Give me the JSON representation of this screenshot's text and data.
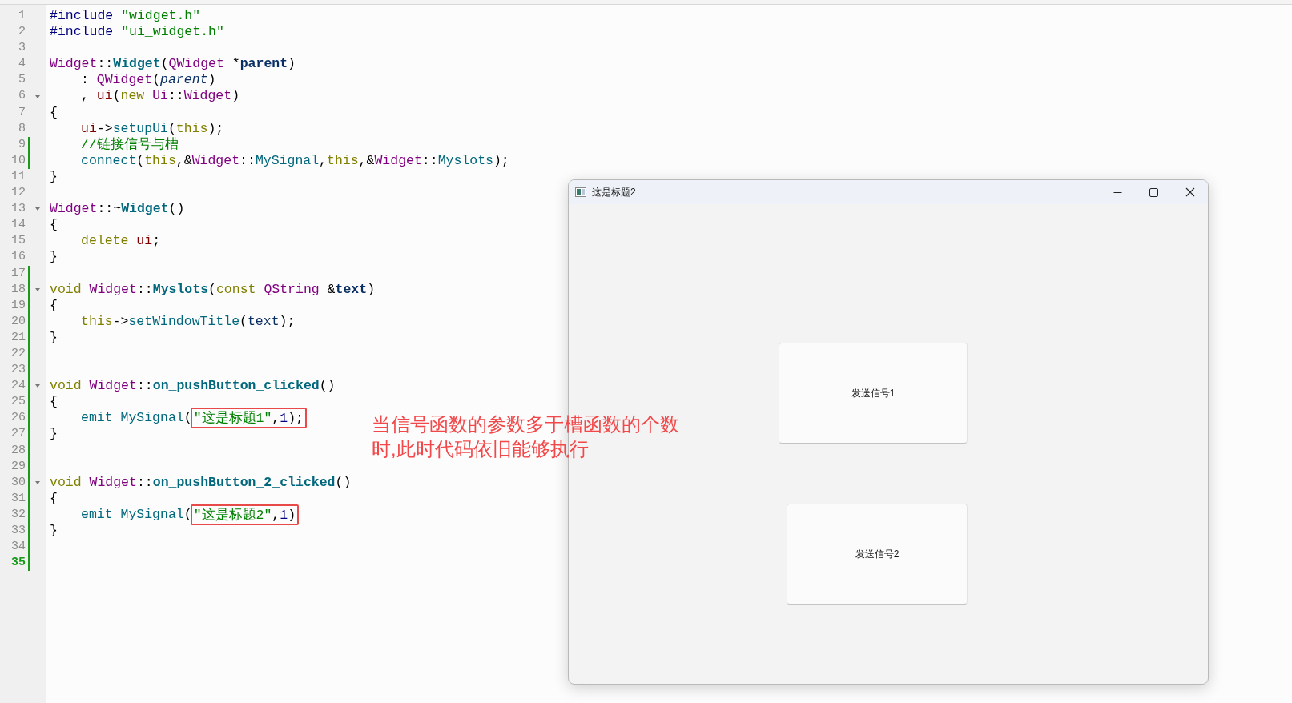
{
  "editor": {
    "lines": [
      {
        "number": "1",
        "foldable": false,
        "modified": false,
        "current": false,
        "indent": false,
        "tokens": [
          {
            "text": "#include ",
            "kind": "preproc"
          },
          {
            "text": "\"widget.h\"",
            "kind": "string"
          }
        ]
      },
      {
        "number": "2",
        "foldable": false,
        "modified": false,
        "current": false,
        "indent": false,
        "tokens": [
          {
            "text": "#include ",
            "kind": "preproc"
          },
          {
            "text": "\"ui_widget.h\"",
            "kind": "string"
          }
        ]
      },
      {
        "number": "3",
        "foldable": false,
        "modified": false,
        "current": false,
        "indent": false
      },
      {
        "number": "4",
        "foldable": false,
        "modified": false,
        "current": false,
        "indent": false,
        "tokens": [
          {
            "text": "Widget",
            "kind": "type"
          },
          {
            "text": "::",
            "kind": "plain"
          },
          {
            "text": "Widget",
            "kind": "decl"
          },
          {
            "text": "(",
            "kind": "plain"
          },
          {
            "text": "QWidget",
            "kind": "type"
          },
          {
            "text": " *",
            "kind": "plain"
          },
          {
            "text": "parent",
            "kind": "param"
          },
          {
            "text": ")",
            "kind": "plain"
          }
        ]
      },
      {
        "number": "5",
        "foldable": false,
        "modified": false,
        "current": false,
        "indent": true,
        "tokens": [
          {
            "text": ": ",
            "kind": "plain"
          },
          {
            "text": "QWidget",
            "kind": "type"
          },
          {
            "text": "(",
            "kind": "plain"
          },
          {
            "text": "parent",
            "kind": "param-ref"
          },
          {
            "text": ")",
            "kind": "plain"
          }
        ]
      },
      {
        "number": "6",
        "foldable": true,
        "modified": false,
        "current": false,
        "indent": true,
        "tokens": [
          {
            "text": ", ",
            "kind": "plain"
          },
          {
            "text": "ui",
            "kind": "field"
          },
          {
            "text": "(",
            "kind": "plain"
          },
          {
            "text": "new ",
            "kind": "keyword"
          },
          {
            "text": "Ui",
            "kind": "type"
          },
          {
            "text": "::",
            "kind": "plain"
          },
          {
            "text": "Widget",
            "kind": "type"
          },
          {
            "text": ")",
            "kind": "plain"
          }
        ]
      },
      {
        "number": "7",
        "foldable": false,
        "modified": false,
        "current": false,
        "indent": false,
        "tokens": [
          {
            "text": "{",
            "kind": "plain"
          }
        ]
      },
      {
        "number": "8",
        "foldable": false,
        "modified": false,
        "current": false,
        "indent": true,
        "tokens": [
          {
            "text": "ui",
            "kind": "field"
          },
          {
            "text": "->",
            "kind": "plain"
          },
          {
            "text": "setupUi",
            "kind": "func"
          },
          {
            "text": "(",
            "kind": "plain"
          },
          {
            "text": "this",
            "kind": "keyword"
          },
          {
            "text": ");",
            "kind": "plain"
          }
        ]
      },
      {
        "number": "9",
        "foldable": false,
        "modified": true,
        "current": false,
        "indent": true,
        "tokens": [
          {
            "text": "//链接信号与槽",
            "kind": "comment"
          }
        ]
      },
      {
        "number": "10",
        "foldable": false,
        "modified": true,
        "current": false,
        "indent": true,
        "tokens": [
          {
            "text": "connect",
            "kind": "func"
          },
          {
            "text": "(",
            "kind": "plain"
          },
          {
            "text": "this",
            "kind": "keyword"
          },
          {
            "text": ",&",
            "kind": "plain"
          },
          {
            "text": "Widget",
            "kind": "type"
          },
          {
            "text": "::",
            "kind": "plain"
          },
          {
            "text": "MySignal",
            "kind": "func"
          },
          {
            "text": ",",
            "kind": "plain"
          },
          {
            "text": "this",
            "kind": "keyword"
          },
          {
            "text": ",&",
            "kind": "plain"
          },
          {
            "text": "Widget",
            "kind": "type"
          },
          {
            "text": "::",
            "kind": "plain"
          },
          {
            "text": "Myslots",
            "kind": "func"
          },
          {
            "text": ");",
            "kind": "plain"
          }
        ]
      },
      {
        "number": "11",
        "foldable": false,
        "modified": false,
        "current": false,
        "indent": false,
        "tokens": [
          {
            "text": "}",
            "kind": "plain"
          }
        ]
      },
      {
        "number": "12",
        "foldable": false,
        "modified": false,
        "current": false,
        "indent": false
      },
      {
        "number": "13",
        "foldable": true,
        "modified": false,
        "current": false,
        "indent": false,
        "tokens": [
          {
            "text": "Widget",
            "kind": "type"
          },
          {
            "text": "::~",
            "kind": "plain"
          },
          {
            "text": "Widget",
            "kind": "decl"
          },
          {
            "text": "()",
            "kind": "plain"
          }
        ]
      },
      {
        "number": "14",
        "foldable": false,
        "modified": false,
        "current": false,
        "indent": false,
        "tokens": [
          {
            "text": "{",
            "kind": "plain"
          }
        ]
      },
      {
        "number": "15",
        "foldable": false,
        "modified": false,
        "current": false,
        "indent": true,
        "tokens": [
          {
            "text": "delete ",
            "kind": "keyword"
          },
          {
            "text": "ui",
            "kind": "field"
          },
          {
            "text": ";",
            "kind": "plain"
          }
        ]
      },
      {
        "number": "16",
        "foldable": false,
        "modified": false,
        "current": false,
        "indent": false,
        "tokens": [
          {
            "text": "}",
            "kind": "plain"
          }
        ]
      },
      {
        "number": "17",
        "foldable": false,
        "modified": true,
        "current": false,
        "indent": false
      },
      {
        "number": "18",
        "foldable": true,
        "modified": true,
        "current": false,
        "indent": false,
        "tokens": [
          {
            "text": "void ",
            "kind": "keyword"
          },
          {
            "text": "Widget",
            "kind": "type"
          },
          {
            "text": "::",
            "kind": "plain"
          },
          {
            "text": "Myslots",
            "kind": "decl"
          },
          {
            "text": "(",
            "kind": "plain"
          },
          {
            "text": "const ",
            "kind": "keyword"
          },
          {
            "text": "QString",
            "kind": "type"
          },
          {
            "text": " &",
            "kind": "plain"
          },
          {
            "text": "text",
            "kind": "param"
          },
          {
            "text": ")",
            "kind": "plain"
          }
        ]
      },
      {
        "number": "19",
        "foldable": false,
        "modified": true,
        "current": false,
        "indent": false,
        "tokens": [
          {
            "text": "{",
            "kind": "plain"
          }
        ]
      },
      {
        "number": "20",
        "foldable": false,
        "modified": true,
        "current": false,
        "indent": true,
        "tokens": [
          {
            "text": "this",
            "kind": "keyword"
          },
          {
            "text": "->",
            "kind": "plain"
          },
          {
            "text": "setWindowTitle",
            "kind": "func"
          },
          {
            "text": "(",
            "kind": "plain"
          },
          {
            "text": "text",
            "kind": "local"
          },
          {
            "text": ");",
            "kind": "plain"
          }
        ]
      },
      {
        "number": "21",
        "foldable": false,
        "modified": true,
        "current": false,
        "indent": false,
        "tokens": [
          {
            "text": "}",
            "kind": "plain"
          }
        ]
      },
      {
        "number": "22",
        "foldable": false,
        "modified": true,
        "current": false,
        "indent": false
      },
      {
        "number": "23",
        "foldable": false,
        "modified": true,
        "current": false,
        "indent": false
      },
      {
        "number": "24",
        "foldable": true,
        "modified": true,
        "current": false,
        "indent": false,
        "tokens": [
          {
            "text": "void ",
            "kind": "keyword"
          },
          {
            "text": "Widget",
            "kind": "type"
          },
          {
            "text": "::",
            "kind": "plain"
          },
          {
            "text": "on_pushButton_clicked",
            "kind": "decl"
          },
          {
            "text": "()",
            "kind": "plain"
          }
        ]
      },
      {
        "number": "25",
        "foldable": false,
        "modified": true,
        "current": false,
        "indent": false,
        "tokens": [
          {
            "text": "{",
            "kind": "plain"
          }
        ]
      },
      {
        "number": "26",
        "foldable": false,
        "modified": true,
        "current": false,
        "indent": true,
        "tokens": [
          {
            "text": "emit ",
            "kind": "macro"
          },
          {
            "text": "MySignal",
            "kind": "func"
          },
          {
            "text": "(",
            "kind": "plain"
          },
          {
            "text": "\"这是标题1\"",
            "kind": "string",
            "boxed": true
          },
          {
            "text": ",",
            "kind": "plain",
            "boxed": true
          },
          {
            "text": "1",
            "kind": "number",
            "boxed": true
          },
          {
            "text": ");",
            "kind": "plain",
            "boxed": true
          }
        ]
      },
      {
        "number": "27",
        "foldable": false,
        "modified": true,
        "current": false,
        "indent": false,
        "tokens": [
          {
            "text": "}",
            "kind": "plain"
          }
        ]
      },
      {
        "number": "28",
        "foldable": false,
        "modified": true,
        "current": false,
        "indent": false
      },
      {
        "number": "29",
        "foldable": false,
        "modified": true,
        "current": false,
        "indent": false
      },
      {
        "number": "30",
        "foldable": true,
        "modified": true,
        "current": false,
        "indent": false,
        "tokens": [
          {
            "text": "void ",
            "kind": "keyword"
          },
          {
            "text": "Widget",
            "kind": "type"
          },
          {
            "text": "::",
            "kind": "plain"
          },
          {
            "text": "on_pushButton_2_clicked",
            "kind": "decl"
          },
          {
            "text": "()",
            "kind": "plain"
          }
        ]
      },
      {
        "number": "31",
        "foldable": false,
        "modified": true,
        "current": false,
        "indent": false,
        "tokens": [
          {
            "text": "{",
            "kind": "plain"
          }
        ]
      },
      {
        "number": "32",
        "foldable": false,
        "modified": true,
        "current": false,
        "indent": true,
        "tokens": [
          {
            "text": "emit ",
            "kind": "macro"
          },
          {
            "text": "MySignal",
            "kind": "func"
          },
          {
            "text": "(",
            "kind": "plain"
          },
          {
            "text": "\"这是标题2\"",
            "kind": "string",
            "boxed": true
          },
          {
            "text": ",",
            "kind": "plain",
            "boxed": true
          },
          {
            "text": "1",
            "kind": "number",
            "boxed": true
          },
          {
            "text": ")",
            "kind": "plain",
            "boxed": true
          }
        ]
      },
      {
        "number": "33",
        "foldable": false,
        "modified": true,
        "current": false,
        "indent": false,
        "tokens": [
          {
            "text": "}",
            "kind": "plain"
          }
        ]
      },
      {
        "number": "34",
        "foldable": false,
        "modified": true,
        "current": false,
        "indent": false
      },
      {
        "number": "35",
        "foldable": false,
        "modified": true,
        "current": true,
        "indent": false
      }
    ]
  },
  "annotation": {
    "lines": [
      "当信号函数的参数多于槽函数的个数",
      "时,此时代码依旧能够执行"
    ]
  },
  "window": {
    "title": "这是标题2",
    "buttons": [
      {
        "label": "发送信号1"
      },
      {
        "label": "发送信号2"
      }
    ]
  }
}
